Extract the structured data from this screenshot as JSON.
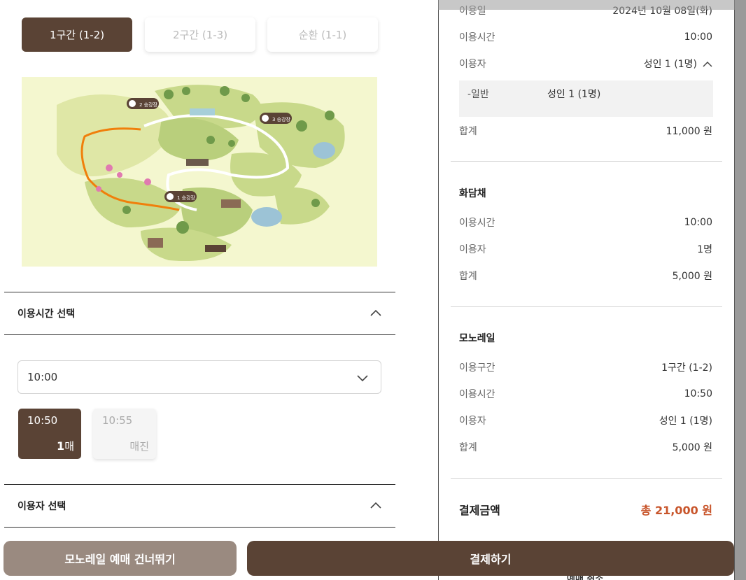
{
  "route_tabs": [
    {
      "label": "1구간 (1-2)"
    },
    {
      "label": "2구간 (1-3)"
    },
    {
      "label": "순환 (1-1)"
    }
  ],
  "map": {
    "stations": [
      {
        "label": "2 승강장"
      },
      {
        "label": "3 승강장"
      },
      {
        "label": "1 승강장"
      }
    ]
  },
  "time_section": {
    "title": "이용시간 선택",
    "select_value": "10:00",
    "slots": [
      {
        "time": "10:50",
        "count_num": "1",
        "count_unit": "매"
      },
      {
        "time": "10:55",
        "status": "매진"
      }
    ]
  },
  "user_section": {
    "title": "이용자 선택"
  },
  "summary": {
    "top": {
      "date_label": "이용일",
      "date_value": "2024년 10월 08일(화)",
      "time_label": "이용시간",
      "time_value": "10:00",
      "user_label": "이용자",
      "user_value": "성인 1 (1명)",
      "sub_label": "-일반",
      "sub_value": "성인 1 (1명)",
      "sum_label": "합계",
      "sum_value": "11,000 원"
    },
    "hwadamchae": {
      "title": "화담채",
      "time_label": "이용시간",
      "time_value": "10:00",
      "user_label": "이용자",
      "user_value": "1명",
      "sum_label": "합계",
      "sum_value": "5,000 원"
    },
    "monorail": {
      "title": "모노레일",
      "route_label": "이용구간",
      "route_value": "1구간 (1-2)",
      "time_label": "이용시간",
      "time_value": "10:50",
      "user_label": "이용자",
      "user_value": "성인 1 (1명)",
      "sum_label": "합계",
      "sum_value": "5,000 원"
    },
    "total_label": "결제금액",
    "total_value": "총 21,000 원",
    "cancel_peek": "예매 취소"
  },
  "buttons": {
    "skip": "모노레일 예매 건너뛰기",
    "pay": "결제하기"
  },
  "colors": {
    "brand_brown": "#5a4335",
    "accent_orange": "#c8552b",
    "map_bg": "#f4f7cf"
  }
}
